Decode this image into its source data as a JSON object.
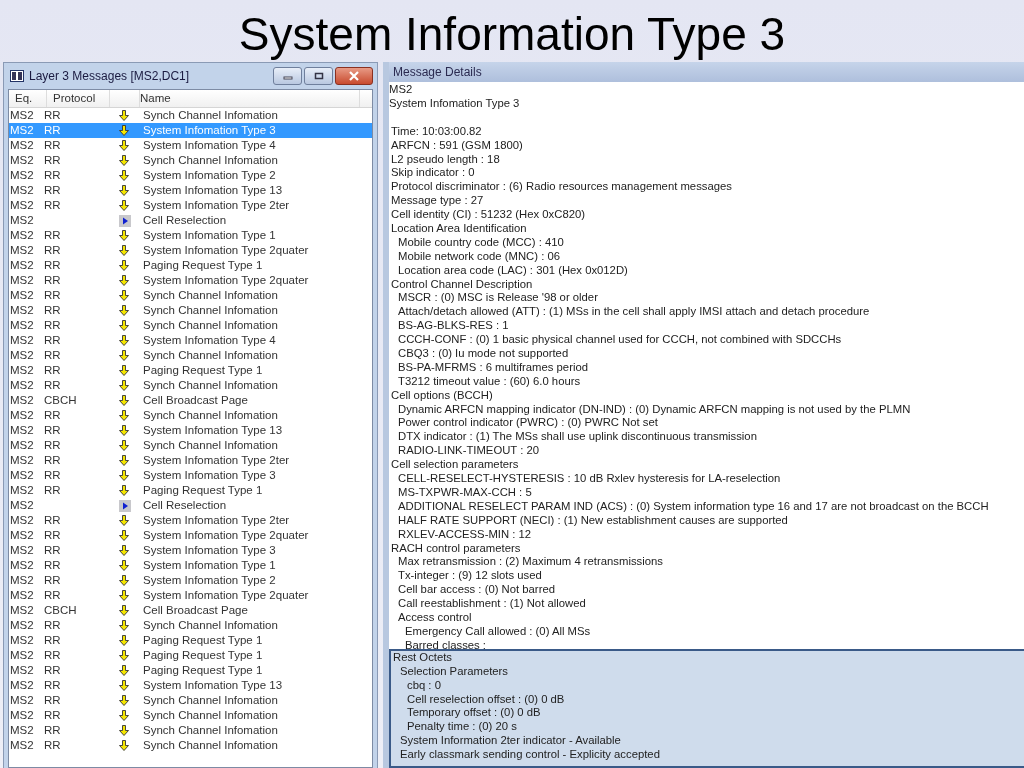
{
  "slide_title": "System Information Type 3",
  "window": {
    "title": "Layer 3 Messages  [MS2,DC1]"
  },
  "table": {
    "columns": [
      "Eq.",
      "Protocol",
      "Name"
    ],
    "rows": [
      {
        "kind": "message",
        "eq": "MS2",
        "protocol": "RR",
        "name": "Synch Channel Infomation",
        "selected": false
      },
      {
        "kind": "message",
        "eq": "MS2",
        "protocol": "RR",
        "name": "System Infomation Type 3",
        "selected": true
      },
      {
        "kind": "message",
        "eq": "MS2",
        "protocol": "RR",
        "name": "System Infomation Type 4",
        "selected": false
      },
      {
        "kind": "message",
        "eq": "MS2",
        "protocol": "RR",
        "name": "Synch Channel Infomation",
        "selected": false
      },
      {
        "kind": "message",
        "eq": "MS2",
        "protocol": "RR",
        "name": "System Infomation Type 2",
        "selected": false
      },
      {
        "kind": "message",
        "eq": "MS2",
        "protocol": "RR",
        "name": "System Infomation Type 13",
        "selected": false
      },
      {
        "kind": "message",
        "eq": "MS2",
        "protocol": "RR",
        "name": "System Infomation Type 2ter",
        "selected": false
      },
      {
        "kind": "event",
        "eq": "MS2",
        "name": "Cell Reselection",
        "selected": false
      },
      {
        "kind": "message",
        "eq": "MS2",
        "protocol": "RR",
        "name": "System Infomation Type 1",
        "selected": false
      },
      {
        "kind": "message",
        "eq": "MS2",
        "protocol": "RR",
        "name": "System Infomation Type 2quater",
        "selected": false
      },
      {
        "kind": "message",
        "eq": "MS2",
        "protocol": "RR",
        "name": "Paging Request Type 1",
        "selected": false
      },
      {
        "kind": "message",
        "eq": "MS2",
        "protocol": "RR",
        "name": "System Infomation Type 2quater",
        "selected": false
      },
      {
        "kind": "message",
        "eq": "MS2",
        "protocol": "RR",
        "name": "Synch Channel Infomation",
        "selected": false
      },
      {
        "kind": "message",
        "eq": "MS2",
        "protocol": "RR",
        "name": "Synch Channel Infomation",
        "selected": false
      },
      {
        "kind": "message",
        "eq": "MS2",
        "protocol": "RR",
        "name": "Synch Channel Infomation",
        "selected": false
      },
      {
        "kind": "message",
        "eq": "MS2",
        "protocol": "RR",
        "name": "System Infomation Type 4",
        "selected": false
      },
      {
        "kind": "message",
        "eq": "MS2",
        "protocol": "RR",
        "name": "Synch Channel Infomation",
        "selected": false
      },
      {
        "kind": "message",
        "eq": "MS2",
        "protocol": "RR",
        "name": "Paging Request Type 1",
        "selected": false
      },
      {
        "kind": "message",
        "eq": "MS2",
        "protocol": "RR",
        "name": "Synch Channel Infomation",
        "selected": false
      },
      {
        "kind": "message",
        "eq": "MS2",
        "protocol": "CBCH",
        "name": "Cell Broadcast Page",
        "selected": false
      },
      {
        "kind": "message",
        "eq": "MS2",
        "protocol": "RR",
        "name": "Synch Channel Infomation",
        "selected": false
      },
      {
        "kind": "message",
        "eq": "MS2",
        "protocol": "RR",
        "name": "System Infomation Type 13",
        "selected": false
      },
      {
        "kind": "message",
        "eq": "MS2",
        "protocol": "RR",
        "name": "Synch Channel Infomation",
        "selected": false
      },
      {
        "kind": "message",
        "eq": "MS2",
        "protocol": "RR",
        "name": "System Infomation Type 2ter",
        "selected": false
      },
      {
        "kind": "message",
        "eq": "MS2",
        "protocol": "RR",
        "name": "System Infomation Type 3",
        "selected": false
      },
      {
        "kind": "message",
        "eq": "MS2",
        "protocol": "RR",
        "name": "Paging Request Type 1",
        "selected": false
      },
      {
        "kind": "event",
        "eq": "MS2",
        "name": "Cell Reselection",
        "selected": false
      },
      {
        "kind": "message",
        "eq": "MS2",
        "protocol": "RR",
        "name": "System Infomation Type 2ter",
        "selected": false
      },
      {
        "kind": "message",
        "eq": "MS2",
        "protocol": "RR",
        "name": "System Infomation Type 2quater",
        "selected": false
      },
      {
        "kind": "message",
        "eq": "MS2",
        "protocol": "RR",
        "name": "System Infomation Type 3",
        "selected": false
      },
      {
        "kind": "message",
        "eq": "MS2",
        "protocol": "RR",
        "name": "System Infomation Type 1",
        "selected": false
      },
      {
        "kind": "message",
        "eq": "MS2",
        "protocol": "RR",
        "name": "System Infomation Type 2",
        "selected": false
      },
      {
        "kind": "message",
        "eq": "MS2",
        "protocol": "RR",
        "name": "System Infomation Type 2quater",
        "selected": false
      },
      {
        "kind": "message",
        "eq": "MS2",
        "protocol": "CBCH",
        "name": "Cell Broadcast Page",
        "selected": false
      },
      {
        "kind": "message",
        "eq": "MS2",
        "protocol": "RR",
        "name": "Synch Channel Infomation",
        "selected": false
      },
      {
        "kind": "message",
        "eq": "MS2",
        "protocol": "RR",
        "name": "Paging Request Type 1",
        "selected": false
      },
      {
        "kind": "message",
        "eq": "MS2",
        "protocol": "RR",
        "name": "Paging Request Type 1",
        "selected": false
      },
      {
        "kind": "message",
        "eq": "MS2",
        "protocol": "RR",
        "name": "Paging Request Type 1",
        "selected": false
      },
      {
        "kind": "message",
        "eq": "MS2",
        "protocol": "RR",
        "name": "System Infomation Type 13",
        "selected": false
      },
      {
        "kind": "message",
        "eq": "MS2",
        "protocol": "RR",
        "name": "Synch Channel Infomation",
        "selected": false
      },
      {
        "kind": "message",
        "eq": "MS2",
        "protocol": "RR",
        "name": "Synch Channel Infomation",
        "selected": false
      },
      {
        "kind": "message",
        "eq": "MS2",
        "protocol": "RR",
        "name": "Synch Channel Infomation",
        "selected": false
      },
      {
        "kind": "message",
        "eq": "MS2",
        "protocol": "RR",
        "name": "Synch Channel Infomation",
        "selected": false
      }
    ]
  },
  "details": {
    "title": "Message Details",
    "header": [
      "MS2",
      "System Infomation Type 3"
    ],
    "fields": [
      {
        "text": "Time: 10:03:00.82"
      },
      {
        "text": "ARFCN : 591 (GSM 1800)"
      },
      {
        "text": "L2 pseudo length : 18"
      },
      {
        "text": "Skip indicator : 0"
      },
      {
        "text": "Protocol discriminator : (6) Radio resources management messages"
      },
      {
        "text": "Message type : 27"
      },
      {
        "text": "Cell identity (CI) : 51232 (Hex 0xC820)"
      },
      {
        "text": "Location Area Identification",
        "children": [
          {
            "text": "Mobile country code (MCC) : 410"
          },
          {
            "text": "Mobile network code (MNC) : 06"
          },
          {
            "text": "Location area code (LAC) : 301 (Hex 0x012D)"
          }
        ]
      },
      {
        "text": "Control Channel Description",
        "children": [
          {
            "text": "MSCR : (0) MSC is Release '98 or older"
          },
          {
            "text": "Attach/detach allowed (ATT) : (1) MSs in the cell shall apply IMSI attach and detach procedure"
          },
          {
            "text": "BS-AG-BLKS-RES : 1"
          },
          {
            "text": "CCCH-CONF : (0) 1 basic physical channel used for CCCH, not combined with SDCCHs"
          },
          {
            "text": "CBQ3 : (0) Iu mode not supported"
          },
          {
            "text": "BS-PA-MFRMS : 6 multiframes period"
          },
          {
            "text": "T3212 timeout value : (60) 6.0 hours"
          }
        ]
      },
      {
        "text": "Cell options (BCCH)",
        "children": [
          {
            "text": "Dynamic ARFCN mapping indicator (DN-IND) : (0) Dynamic ARFCN mapping is not used by the PLMN"
          },
          {
            "text": "Power control indicator (PWRC) : (0) PWRC Not set"
          },
          {
            "text": "DTX indicator : (1) The MSs shall use uplink discontinuous transmission"
          },
          {
            "text": "RADIO-LINK-TIMEOUT : 20"
          }
        ]
      },
      {
        "text": "Cell selection parameters",
        "children": [
          {
            "text": "CELL-RESELECT-HYSTERESIS : 10 dB Rxlev hysteresis for LA-reselection"
          },
          {
            "text": "MS-TXPWR-MAX-CCH : 5"
          },
          {
            "text": "ADDITIONAL RESELECT PARAM IND (ACS) : (0) System information type 16 and 17 are not broadcast on the BCCH"
          },
          {
            "text": "HALF RATE SUPPORT (NECI) : (1) New establishment causes are supported"
          },
          {
            "text": "RXLEV-ACCESS-MIN : 12"
          }
        ]
      },
      {
        "text": "RACH control parameters",
        "children": [
          {
            "text": "Max retransmission : (2) Maximum 4 retransmissions"
          },
          {
            "text": "Tx-integer : (9) 12 slots used"
          },
          {
            "text": "Cell bar access : (0) Not barred"
          },
          {
            "text": "Call reestablishment : (1) Not allowed"
          },
          {
            "text": "Access control",
            "children": [
              {
                "text": "Emergency Call allowed : (0) All MSs"
              },
              {
                "text": "Barred classes :"
              }
            ]
          }
        ]
      }
    ],
    "rest_octets": [
      {
        "text": "Rest Octets",
        "children": [
          {
            "text": "Selection Parameters",
            "children": [
              {
                "text": "cbq : 0"
              },
              {
                "text": "Cell reselection offset : (0) 0 dB"
              },
              {
                "text": "Temporary offset : (0) 0 dB"
              },
              {
                "text": "Penalty time : (0) 20 s"
              }
            ]
          },
          {
            "text": "System Information 2ter indicator - Available"
          },
          {
            "text": "Early classmark sending control - Explicity accepted"
          }
        ]
      }
    ]
  }
}
